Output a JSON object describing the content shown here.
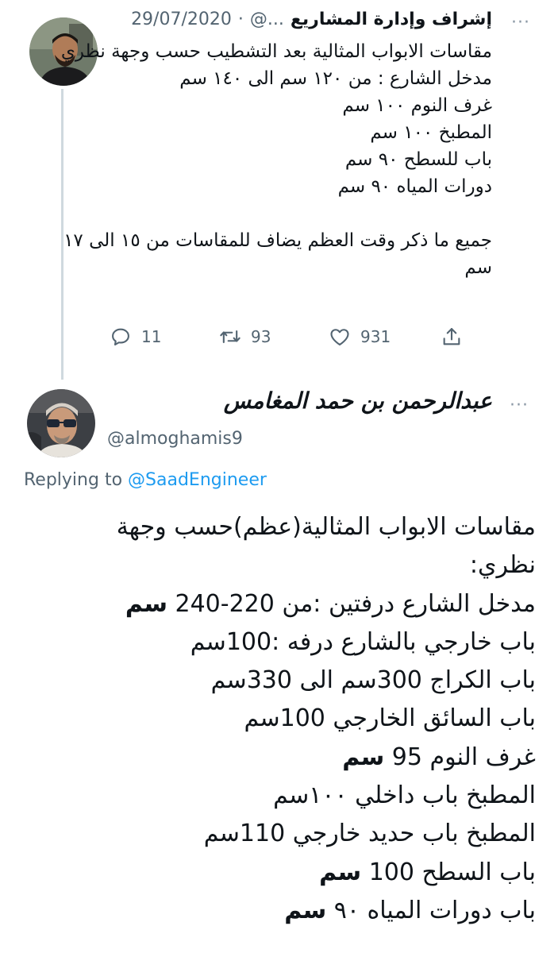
{
  "parent_tweet": {
    "author_name": "إشراف وإدارة المشاريع",
    "handle": "@...",
    "separator": "·",
    "date": "29/07/2020",
    "more": "···",
    "lines": [
      "مقاسات الابواب المثالية بعد التشطيب حسب وجهة نظري",
      "مدخل الشارع : من ١٢٠ سم الى ١٤٠ سم",
      "غرف النوم ١٠٠ سم",
      "المطبخ ١٠٠ سم",
      "باب للسطح ٩٠ سم",
      "دورات المياه ٩٠ سم",
      "",
      "جميع ما ذكر وقت العظم يضاف للمقاسات من ١٥ الى ١٧ سم"
    ],
    "actions": {
      "replies": "11",
      "retweets": "93",
      "likes": "931"
    },
    "icons": [
      "reply-icon",
      "retweet-icon",
      "like-icon",
      "share-icon"
    ]
  },
  "reply_tweet": {
    "author_name": "عبدالرحمن بن حمد المغامس",
    "handle": "@almoghamis9",
    "more": "···",
    "replying_prefix": "Replying to",
    "replying_mention": "@SaadEngineer",
    "lines": [
      {
        "normal": "مقاسات الابواب المثالية(عظم)حسب وجهة",
        "bold": ""
      },
      {
        "normal": "نظري:",
        "bold": ""
      },
      {
        "normal": "مدخل الشارع درفتين :من 220-240 ",
        "bold": "سم"
      },
      {
        "normal": "باب خارجي بالشارع درفه :100سم",
        "bold": ""
      },
      {
        "normal": "باب الكراج 300سم الى 330سم",
        "bold": ""
      },
      {
        "normal": "باب السائق الخارجي 100سم",
        "bold": ""
      },
      {
        "normal": "غرف النوم 95 ",
        "bold": "سم"
      },
      {
        "normal": "المطبخ  باب داخلي ١٠٠سم",
        "bold": ""
      },
      {
        "normal": "المطبخ باب حديد خارجي 110سم",
        "bold": ""
      },
      {
        "normal": "باب السطح 100 ",
        "bold": "سم"
      },
      {
        "normal": "باب دورات المياه ٩٠ ",
        "bold": "سم"
      }
    ]
  },
  "colors": {
    "text": "#0f1419",
    "secondary": "#536471",
    "link": "#1d9bf0",
    "thread_line": "#cfd9de"
  }
}
